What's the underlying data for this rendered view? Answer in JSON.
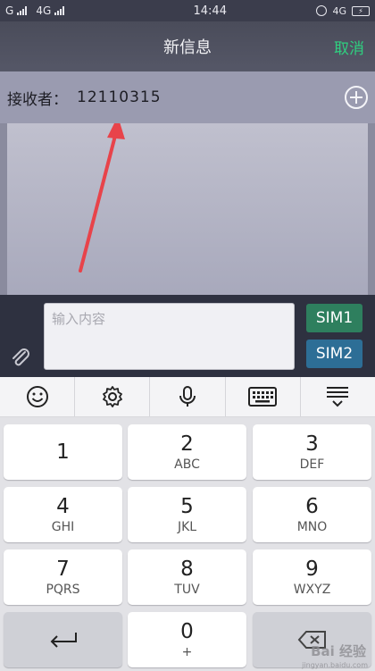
{
  "status": {
    "carrier1": "G",
    "carrier2": "4G",
    "time": "14:44",
    "right_network": "4G"
  },
  "header": {
    "title": "新信息",
    "cancel_label": "取消"
  },
  "recipient": {
    "label": "接收者：",
    "value": "12110315"
  },
  "compose": {
    "placeholder": "输入内容",
    "sim1_label": "SIM1",
    "sim2_label": "SIM2"
  },
  "toolbar": {
    "items": [
      "emoji-icon",
      "gear-icon",
      "microphone-icon",
      "keyboard-icon",
      "layout-collapse-icon"
    ]
  },
  "keypad": {
    "keys": [
      {
        "digit": "1",
        "letters": ""
      },
      {
        "digit": "2",
        "letters": "ABC"
      },
      {
        "digit": "3",
        "letters": "DEF"
      },
      {
        "digit": "4",
        "letters": "GHI"
      },
      {
        "digit": "5",
        "letters": "JKL"
      },
      {
        "digit": "6",
        "letters": "MNO"
      },
      {
        "digit": "7",
        "letters": "PQRS"
      },
      {
        "digit": "8",
        "letters": "TUV"
      },
      {
        "digit": "9",
        "letters": "WXYZ"
      },
      {
        "digit": "0",
        "letters": "+"
      }
    ]
  },
  "watermark": {
    "brand": "Bai 经验",
    "url": "jingyan.baidu.com"
  },
  "colors": {
    "accent_green": "#2fd080",
    "sim1": "#2e7f5e",
    "sim2": "#2d6e96",
    "annotation_arrow": "#e8434a"
  }
}
